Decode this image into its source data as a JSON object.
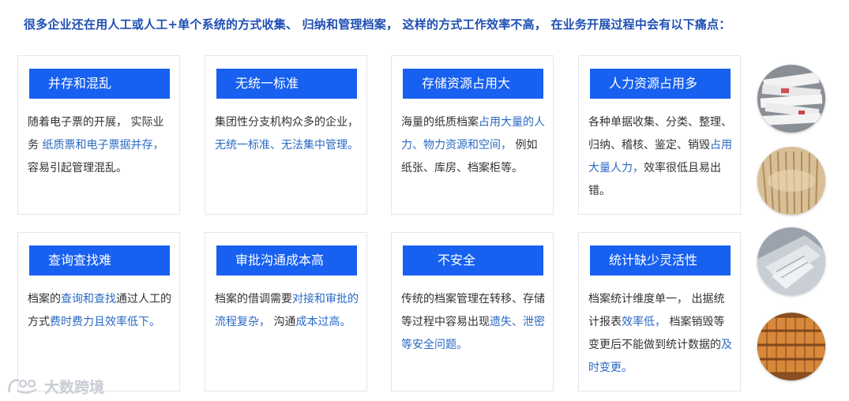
{
  "headline": "很多企业还在用人工或人工+单个系统的方式收集、 归纳和管理档案， 这样的方式工作效率不高， 在业务开展过程中会有以下痛点：",
  "cards": [
    {
      "title": "并存和混乱",
      "parts": [
        {
          "t": "随着电子票的开展， 实际业务 ",
          "h": false
        },
        {
          "t": "纸质票和电子票据并存，",
          "h": true
        },
        {
          "t": " 容易引起管理混乱。",
          "h": false
        }
      ]
    },
    {
      "title": "无统一标准",
      "parts": [
        {
          "t": "集团性分支机构众多的企业， ",
          "h": false
        },
        {
          "t": "无统一标准、无法集中管理。",
          "h": true
        }
      ]
    },
    {
      "title": "存储资源占用大",
      "parts": [
        {
          "t": "海量的纸质档案",
          "h": false
        },
        {
          "t": "占用大量的人力、物力资源和空间，",
          "h": true
        },
        {
          "t": " 例如纸张、库房、档案柜等。",
          "h": false
        }
      ]
    },
    {
      "title": "人力资源占用多",
      "parts": [
        {
          "t": "各种单据收集、分类、整理、 归纳、稽核、鉴定、销毁",
          "h": false
        },
        {
          "t": "占用大量人力，",
          "h": true
        },
        {
          "t": "效率很低且易出错。",
          "h": false
        }
      ]
    },
    {
      "title": "查询查找难",
      "parts": [
        {
          "t": "档案的",
          "h": false
        },
        {
          "t": "查询和查找",
          "h": true
        },
        {
          "t": "通过人工的方式",
          "h": false
        },
        {
          "t": "费时费力且效率低下。",
          "h": true
        }
      ]
    },
    {
      "title": "审批沟通成本高",
      "parts": [
        {
          "t": "档案的借调需要",
          "h": false
        },
        {
          "t": "对接和审批的流程复杂，",
          "h": true
        },
        {
          "t": " 沟通",
          "h": false
        },
        {
          "t": "成本过高。",
          "h": true
        }
      ]
    },
    {
      "title": "不安全",
      "parts": [
        {
          "t": "传统的档案管理在转移、存储等过程中容易出现",
          "h": false
        },
        {
          "t": "遗失、泄密等安全问题。",
          "h": true
        }
      ]
    },
    {
      "title": "统计缺少灵活性",
      "parts": [
        {
          "t": "档案统计维度单一， 出据统计报表",
          "h": false
        },
        {
          "t": "效率低，",
          "h": true
        },
        {
          "t": " 档案销毁等变更后不能做到统计数据的",
          "h": false
        },
        {
          "t": "及时变更。",
          "h": true
        }
      ]
    }
  ],
  "photos": [
    "paper-stack-photo",
    "rolled-documents-photo",
    "folders-photo",
    "archive-shelves-photo"
  ],
  "watermark": "大数跨境",
  "colors": {
    "headline": "#1f4fb4",
    "title_bg": "#1760f0",
    "highlight": "#2a6ac4",
    "body_text": "#333333"
  }
}
